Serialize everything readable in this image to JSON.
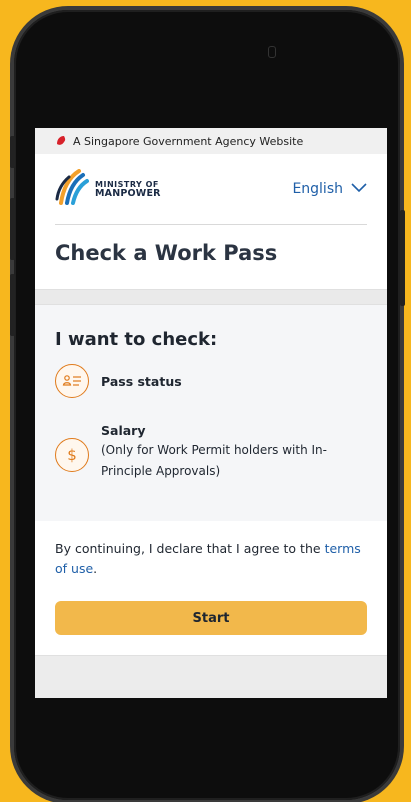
{
  "colors": {
    "background": "#F7B71E",
    "accent_orange": "#E07B1C",
    "button": "#F2B84B",
    "link": "#1F5FA8"
  },
  "gov_bar": {
    "text": "A Singapore Government Agency Website",
    "icon": "singapore-lion-icon"
  },
  "header": {
    "logo_line1": "MINISTRY OF",
    "logo_line2": "MANPOWER",
    "language": "English",
    "language_icon": "chevron-down-icon"
  },
  "page": {
    "title": "Check a Work Pass"
  },
  "options": {
    "heading": "I want to check:",
    "items": [
      {
        "label": "Pass status",
        "icon": "person-card-icon"
      },
      {
        "label": "Salary",
        "sub": "(Only for Work Permit holders with In-Principle Approvals)",
        "icon": "dollar-icon"
      }
    ]
  },
  "agreement": {
    "text": "By continuing, I declare that I agree to the",
    "link": "terms of use",
    "suffix": "."
  },
  "actions": {
    "start_label": "Start"
  }
}
